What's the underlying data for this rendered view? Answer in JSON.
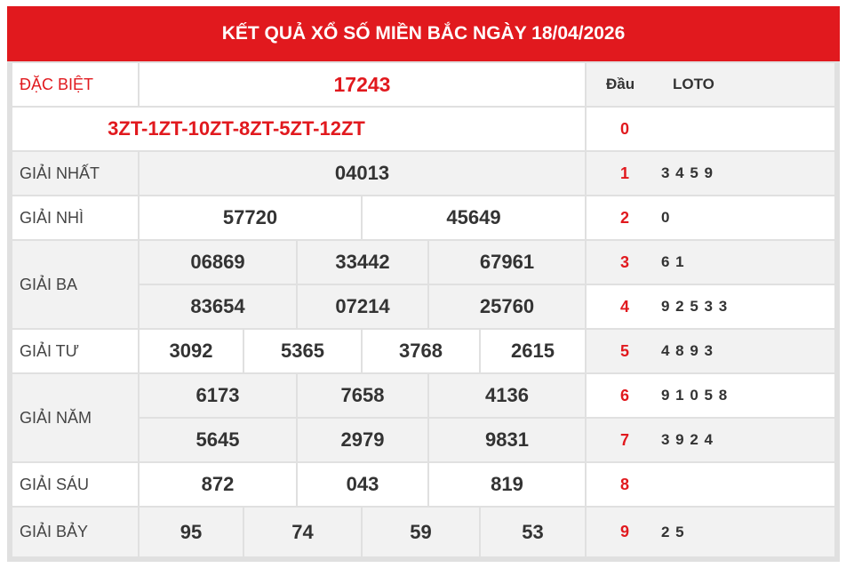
{
  "title": "KẾT QUẢ XỔ SỐ MIỀN BẮC NGÀY 18/04/2026",
  "special": {
    "label": "ĐẶC BIỆT",
    "value": "17243",
    "codes": "3ZT-1ZT-10ZT-8ZT-5ZT-12ZT"
  },
  "first": {
    "label": "GIẢI NHẤT",
    "values": [
      "04013"
    ]
  },
  "second": {
    "label": "GIẢI NHÌ",
    "values": [
      "57720",
      "45649"
    ]
  },
  "third": {
    "label": "GIẢI BA",
    "values": [
      "06869",
      "33442",
      "67961",
      "83654",
      "07214",
      "25760"
    ]
  },
  "fourth": {
    "label": "GIẢI TƯ",
    "values": [
      "3092",
      "5365",
      "3768",
      "2615"
    ]
  },
  "fifth": {
    "label": "GIẢI NĂM",
    "values": [
      "6173",
      "7658",
      "4136",
      "5645",
      "2979",
      "9831"
    ]
  },
  "sixth": {
    "label": "GIẢI SÁU",
    "values": [
      "872",
      "043",
      "819"
    ]
  },
  "seventh": {
    "label": "GIẢI BẢY",
    "values": [
      "95",
      "74",
      "59",
      "53"
    ]
  },
  "loto": {
    "head_label": "Đầu",
    "loto_label": "LOTO",
    "rows": [
      {
        "head": "0",
        "digits": ""
      },
      {
        "head": "1",
        "digits": "3 4 5 9"
      },
      {
        "head": "2",
        "digits": "0"
      },
      {
        "head": "3",
        "digits": "6 1"
      },
      {
        "head": "4",
        "digits": "9 2 5 3 3"
      },
      {
        "head": "5",
        "digits": "4 8 9 3"
      },
      {
        "head": "6",
        "digits": "9 1 0 5 8"
      },
      {
        "head": "7",
        "digits": "3 9 2 4"
      },
      {
        "head": "8",
        "digits": ""
      },
      {
        "head": "9",
        "digits": "2 5"
      }
    ]
  },
  "colors": {
    "accent": "#e1191e",
    "row_alt": "#f2f2f2",
    "border": "#e0e0e0"
  }
}
